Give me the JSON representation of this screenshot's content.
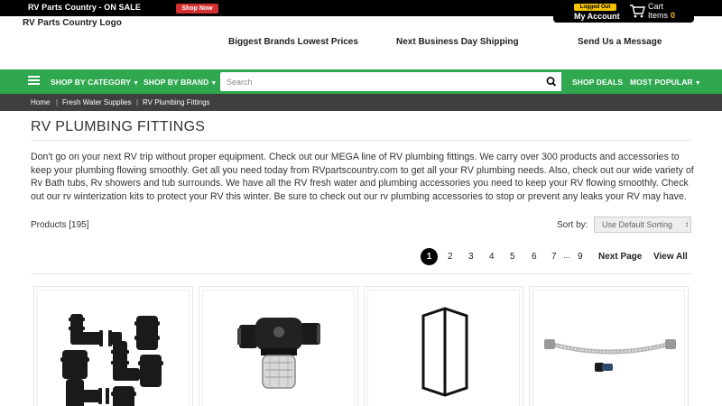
{
  "topbar": {
    "promo": "RV Parts Country - ON SALE",
    "shop_now": "Shop Now",
    "logged_out": "Logged Out",
    "my_account": "My Account",
    "cart": "Cart",
    "items_label": "Items",
    "items_count": "0"
  },
  "header": {
    "logo": "RV Parts Country Logo",
    "usps": [
      "Biggest Brands Lowest Prices",
      "Next Business Day Shipping",
      "Send Us a Message"
    ]
  },
  "nav": {
    "shop_by_category": "SHOP BY CATEGORY",
    "shop_by_brand": "SHOP BY BRAND",
    "search_placeholder": "Search",
    "shop_deals": "SHOP DEALS",
    "most_popular": "MOST POPULAR"
  },
  "breadcrumb": [
    "Home",
    "Fresh Water Supplies",
    "RV Plumbing Fittings"
  ],
  "page": {
    "title": "RV PLUMBING FITTINGS",
    "description": "Don't go on your next RV trip without proper equipment. Check out our MEGA line of RV plumbing fittings. We carry over 300 products and accessories to keep your plumbing flowing smoothly. Get all you need today from RVpartscountry.com to get all your RV plumbing needs.  Also, check out our wide variety of Rv Bath tubs, Rv showers and tub surrounds.  We have all the RV fresh water and plumbing accessories you need to keep your RV flowing smoothly.  Check out our rv winterization kits to protect your RV this winter.  Be sure to check out our rv plumbing accessories to stop or prevent any leaks your RV may have.",
    "products_count": "Products [195]",
    "sort_label": "Sort by:",
    "sort_value": "Use Default Sorting"
  },
  "pagination": {
    "current": "1",
    "pages": [
      "2",
      "3",
      "4",
      "5",
      "6",
      "7"
    ],
    "ellipsis": "...",
    "last": "9",
    "next": "Next Page",
    "view_all": "View All"
  },
  "products": [
    {
      "icon": "elbow-fittings-image"
    },
    {
      "icon": "water-strainer-image"
    },
    {
      "icon": "tube-sleeve-image"
    },
    {
      "icon": "braided-hose-image"
    }
  ]
}
